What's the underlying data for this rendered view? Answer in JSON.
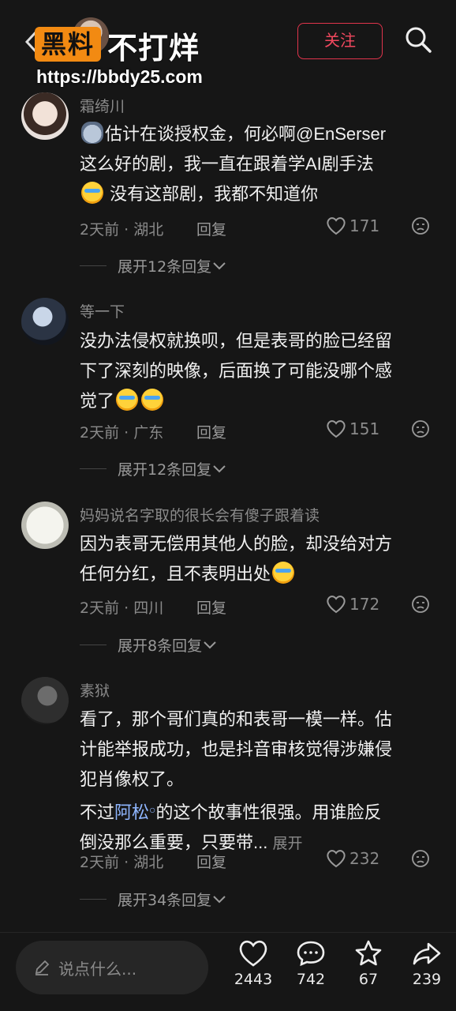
{
  "header": {
    "logo_part1": "黑料",
    "logo_part2": "不打烊",
    "site_url": "https://bbdy25.com",
    "follow_label": "关注"
  },
  "comments": [
    {
      "name": "霜绮川",
      "text_parts": [
        "估计在谈授权金，何必啊@EnSerser",
        "这么好的剧，我一直在跟着学AI剧手法",
        "没有这部剧，我都不知道你"
      ],
      "date_loc": "2天前 · 湖北",
      "reply": "回复",
      "likes": "171",
      "expand": "展开12条回复"
    },
    {
      "name": "等一下",
      "text_parts": [
        "没办法侵权就换呗，但是表哥的脸已经留",
        "下了深刻的映像，后面换了可能没哪个感",
        "觉了"
      ],
      "date_loc": "2天前 · 广东",
      "reply": "回复",
      "likes": "151",
      "expand": "展开12条回复"
    },
    {
      "name": "妈妈说名字取的很长会有傻子跟着读",
      "text_parts": [
        "因为表哥无偿用其他人的脸，却没给对方",
        "任何分红，且不表明出处"
      ],
      "date_loc": "2天前 · 四川",
      "reply": "回复",
      "likes": "172",
      "expand": "展开8条回复"
    },
    {
      "name": "素狱",
      "text_parts": [
        "看了，那个哥们真的和表哥一模一样。估",
        "计能举报成功，也是抖音审核觉得涉嫌侵",
        "犯肖像权了。",
        "不过",
        "阿松",
        "的这个故事性很强。用谁脸反",
        "倒没那么重要，只要带...",
        "展开"
      ],
      "date_loc": "2天前 · 湖北",
      "reply": "回复",
      "likes": "232",
      "expand": "展开34条回复"
    }
  ],
  "bottom": {
    "input_placeholder": "说点什么...",
    "likes": "2443",
    "comments": "742",
    "favorites": "67",
    "shares": "239"
  },
  "colors": {
    "accent": "#f0485e",
    "link": "#8fb6ff",
    "background": "#161616"
  }
}
